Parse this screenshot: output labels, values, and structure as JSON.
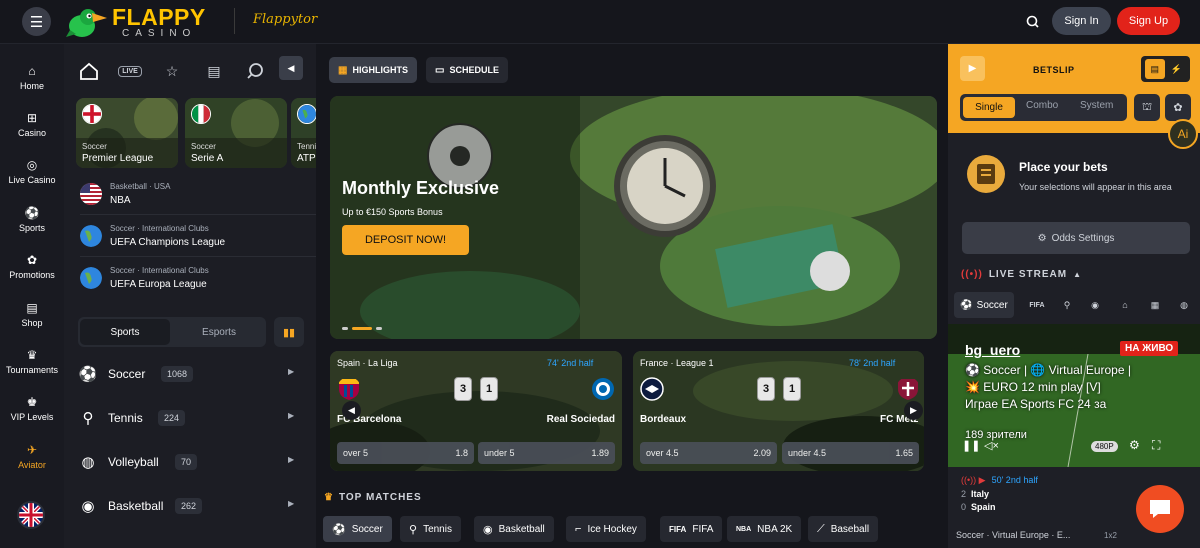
{
  "header": {
    "logo_title": "FLAPPY",
    "logo_subtitle": "CASINO",
    "partner_logo": "Flappytor",
    "signin_label": "Sign In",
    "signup_label": "Sign Up"
  },
  "rail": {
    "items": [
      {
        "label": "Home",
        "icon": "home-icon"
      },
      {
        "label": "Casino",
        "icon": "gamepad-icon"
      },
      {
        "label": "Live Casino",
        "icon": "roulette-icon"
      },
      {
        "label": "Sports",
        "icon": "ball-icon"
      },
      {
        "label": "Promotions",
        "icon": "gift-icon"
      },
      {
        "label": "Shop",
        "icon": "shop-icon"
      },
      {
        "label": "Tournaments",
        "icon": "trophy-icon"
      },
      {
        "label": "VIP Levels",
        "icon": "crown-icon"
      },
      {
        "label": "Aviator",
        "icon": "plane-icon"
      }
    ]
  },
  "sidebar": {
    "icons": [
      "home-icon",
      "live-icon",
      "star-icon",
      "betslip-icon",
      "search-icon"
    ],
    "live_badge": "LIVE",
    "leagues": [
      {
        "sport": "Soccer",
        "name": "Premier League"
      },
      {
        "sport": "Soccer",
        "name": "Serie A"
      },
      {
        "sport": "Tennis",
        "name": "ATP"
      }
    ],
    "rows": [
      {
        "meta": "Basketball · USA",
        "name": "NBA"
      },
      {
        "meta": "Soccer · International Clubs",
        "name": "UEFA Champions League"
      },
      {
        "meta": "Soccer · International Clubs",
        "name": "UEFA Europa League"
      }
    ],
    "tabs": [
      "Sports",
      "Esports"
    ],
    "sports": [
      {
        "name": "Soccer",
        "count": "1068"
      },
      {
        "name": "Tennis",
        "count": "224"
      },
      {
        "name": "Volleyball",
        "count": "70"
      },
      {
        "name": "Basketball",
        "count": "262"
      }
    ]
  },
  "main": {
    "tabs": [
      "HIGHLIGHTS",
      "SCHEDULE"
    ],
    "hero": {
      "title": "Monthly Exclusive",
      "subtitle": "Up to €150 Sports Bonus",
      "button": "DEPOSIT NOW!"
    },
    "matches": [
      {
        "league": "Spain · La Liga",
        "status": "74' 2nd half",
        "home": "FC Barcelona",
        "away": "Real Sociedad",
        "score_home": "3",
        "score_away": "1",
        "odds": [
          {
            "label": "over 5",
            "value": "1.8"
          },
          {
            "label": "under 5",
            "value": "1.89"
          }
        ]
      },
      {
        "league": "France · League 1",
        "status": "78' 2nd half",
        "home": "Bordeaux",
        "away": "FC Metz",
        "score_home": "3",
        "score_away": "1",
        "odds": [
          {
            "label": "over 4.5",
            "value": "2.09"
          },
          {
            "label": "under 4.5",
            "value": "1.65"
          }
        ]
      }
    ],
    "top_matches_title": "TOP MATCHES",
    "chips": [
      "Soccer",
      "Tennis",
      "Basketball",
      "Ice Hockey",
      "FIFA",
      "NBA 2K",
      "Baseball"
    ],
    "chip_badges": [
      "FIFA",
      "NBA"
    ]
  },
  "betslip": {
    "title": "BETSLIP",
    "modes": [
      "Single",
      "Combo",
      "System"
    ],
    "place_title": "Place your bets",
    "place_sub": "Your selections will appear in this area",
    "odds_settings": "Odds Settings"
  },
  "live_stream": {
    "title": "LIVE STREAM",
    "tab": "Soccer",
    "channel": "bg_uero",
    "live_badge": "НА ЖИВО",
    "desc_line1": "⚽ Soccer | 🌐 Virtual Europe | 💥 EURO 12 min play [V]",
    "desc_line2": "Играе EA Sports FC 24 за",
    "viewers": "189 зрители",
    "quality": "480P",
    "ai_label": "Ai",
    "mini_status": "50' 2nd half",
    "mini_rows": [
      {
        "score": "2",
        "team": "Italy"
      },
      {
        "score": "0",
        "team": "Spain"
      }
    ],
    "breadcrumb": "Soccer · Virtual Europe · E...",
    "market": "1x2"
  },
  "colors": {
    "accent": "#f5a623",
    "signup": "#e2231a",
    "live": "#2ea5ff"
  }
}
